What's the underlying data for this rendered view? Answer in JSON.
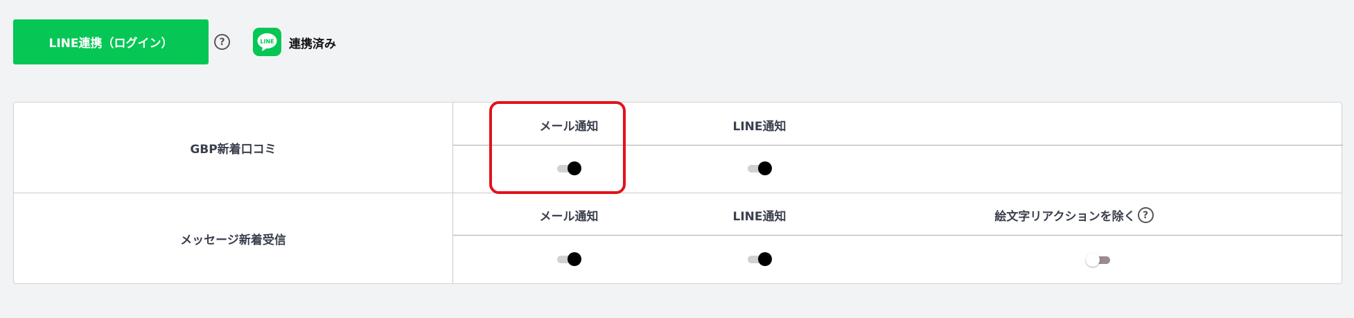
{
  "header": {
    "line_button_label": "LINE連携（ログイン）",
    "help_symbol": "?",
    "line_logo_text": "LINE",
    "linked_status": "連携済み"
  },
  "settings": {
    "rows": [
      {
        "label": "GBP新着口コミ",
        "columns": [
          {
            "header": "メール通知",
            "enabled": true
          },
          {
            "header": "LINE通知",
            "enabled": true
          }
        ]
      },
      {
        "label": "メッセージ新着受信",
        "columns": [
          {
            "header": "メール通知",
            "enabled": true
          },
          {
            "header": "LINE通知",
            "enabled": true
          },
          {
            "header": "絵文字リアクションを除く",
            "enabled": false,
            "help_symbol": "?"
          }
        ]
      }
    ]
  },
  "colors": {
    "line_green": "#06c755",
    "highlight_red": "#e3121a",
    "toggle_on_knob": "#000000",
    "toggle_off_track": "#9c8a8e"
  },
  "annotation": {
    "highlighted_item": "GBP新着口コミ メール通知"
  }
}
